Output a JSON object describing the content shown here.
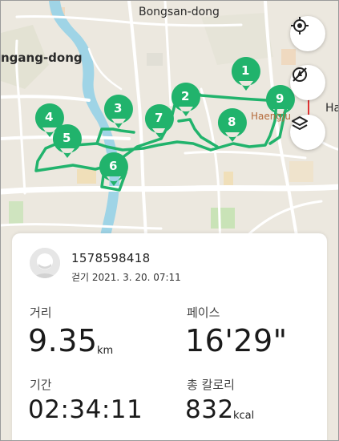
{
  "map": {
    "area_labels": {
      "top": "Bongsan-dong",
      "left": "ngang-dong",
      "right_station": "Haengju",
      "right_edge": "Ha"
    },
    "waypoints": [
      "1",
      "2",
      "3",
      "4",
      "5",
      "6",
      "7",
      "8",
      "9"
    ],
    "route_color": "#21b36c",
    "buttons": {
      "locate_icon": "crosshair-icon",
      "rotate_icon": "compass-off-icon",
      "layers_icon": "layers-icon"
    }
  },
  "record": {
    "user_id": "1578598418",
    "activity_date": "걷기 2021. 3. 20. 07:11",
    "distance": {
      "label": "거리",
      "value": "9.35",
      "unit": "km"
    },
    "pace": {
      "label": "페이스",
      "value": "16'29\""
    },
    "duration": {
      "label": "기간",
      "value": "02:34:11"
    },
    "calories": {
      "label": "총 칼로리",
      "value": "832",
      "unit": "kcal"
    }
  }
}
